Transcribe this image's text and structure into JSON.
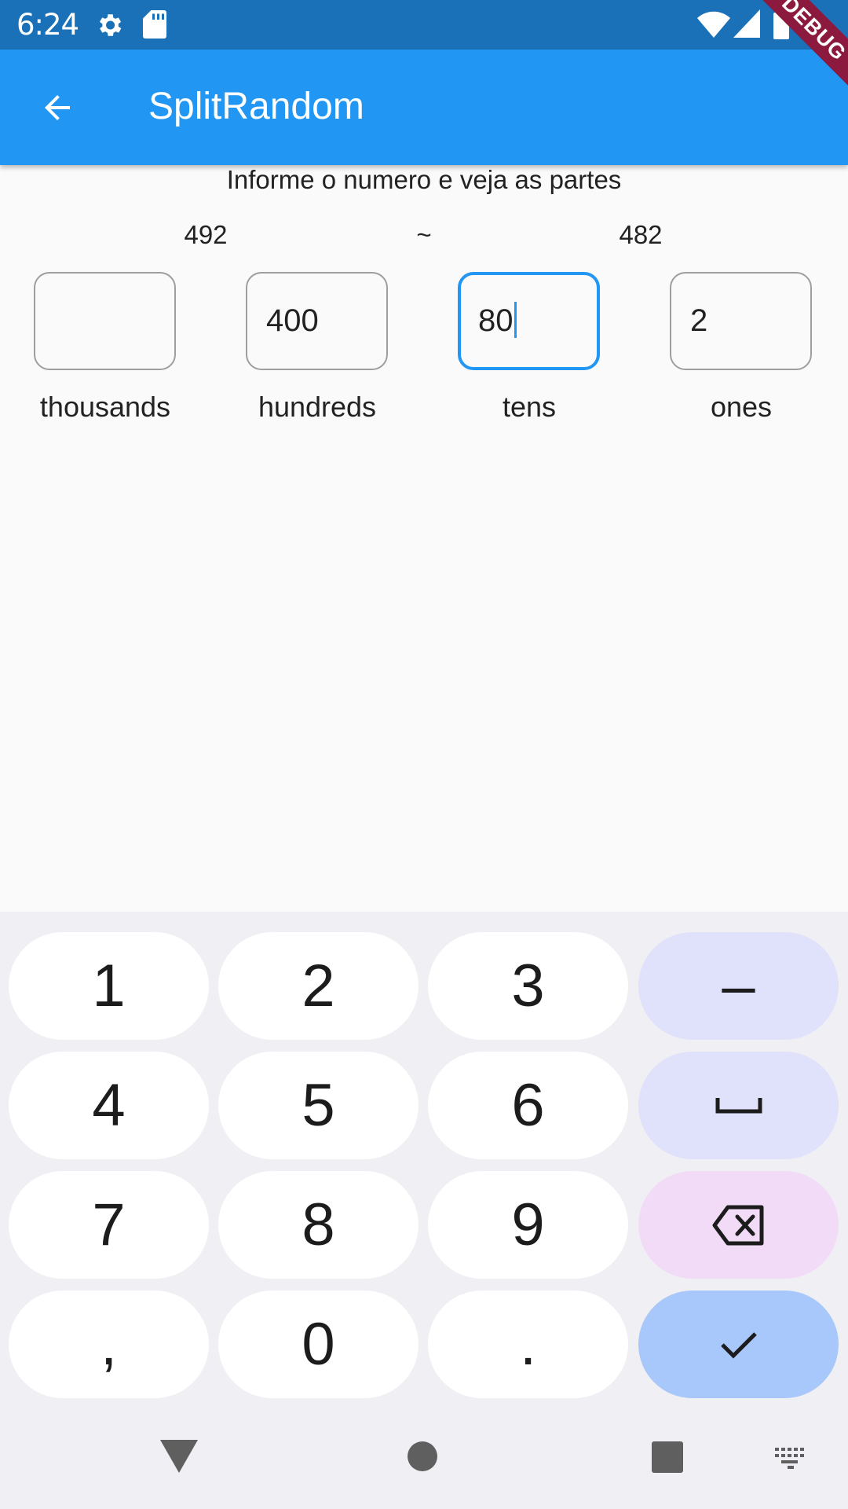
{
  "status_bar": {
    "time": "6:24",
    "icons": [
      "gear-icon",
      "sd-card-icon",
      "wifi-icon",
      "signal-icon",
      "battery-icon"
    ]
  },
  "debug_banner": "DEBUG",
  "app_bar": {
    "title": "SplitRandom",
    "back_icon": "arrow-back-icon",
    "background": "#2196f3"
  },
  "content": {
    "instructions": "Informe o numero e veja as partes",
    "target_number": "492",
    "approx_symbol": "~",
    "current_sum": "482",
    "fields": [
      {
        "label": "thousands",
        "value": ""
      },
      {
        "label": "hundreds",
        "value": "400"
      },
      {
        "label": "tens",
        "value": "80",
        "focused": true
      },
      {
        "label": "ones",
        "value": "2"
      }
    ],
    "focus_color": "#2196f3"
  },
  "keyboard": {
    "keys": {
      "k1": "1",
      "k2": "2",
      "k3": "3",
      "minus": "–",
      "k4": "4",
      "k5": "5",
      "k6": "6",
      "space": "space-icon",
      "k7": "7",
      "k8": "8",
      "k9": "9",
      "backspace": "backspace-icon",
      "comma": ",",
      "k0": "0",
      "period": ".",
      "enter": "check-icon"
    },
    "colors": {
      "function_key": "#e0e1fa",
      "backspace_key": "#f2dbf7",
      "enter_key": "#a8c7fa"
    }
  },
  "nav_bar": {
    "icons": [
      "nav-back-icon",
      "nav-home-icon",
      "nav-recents-icon",
      "keyboard-switch-icon"
    ]
  }
}
